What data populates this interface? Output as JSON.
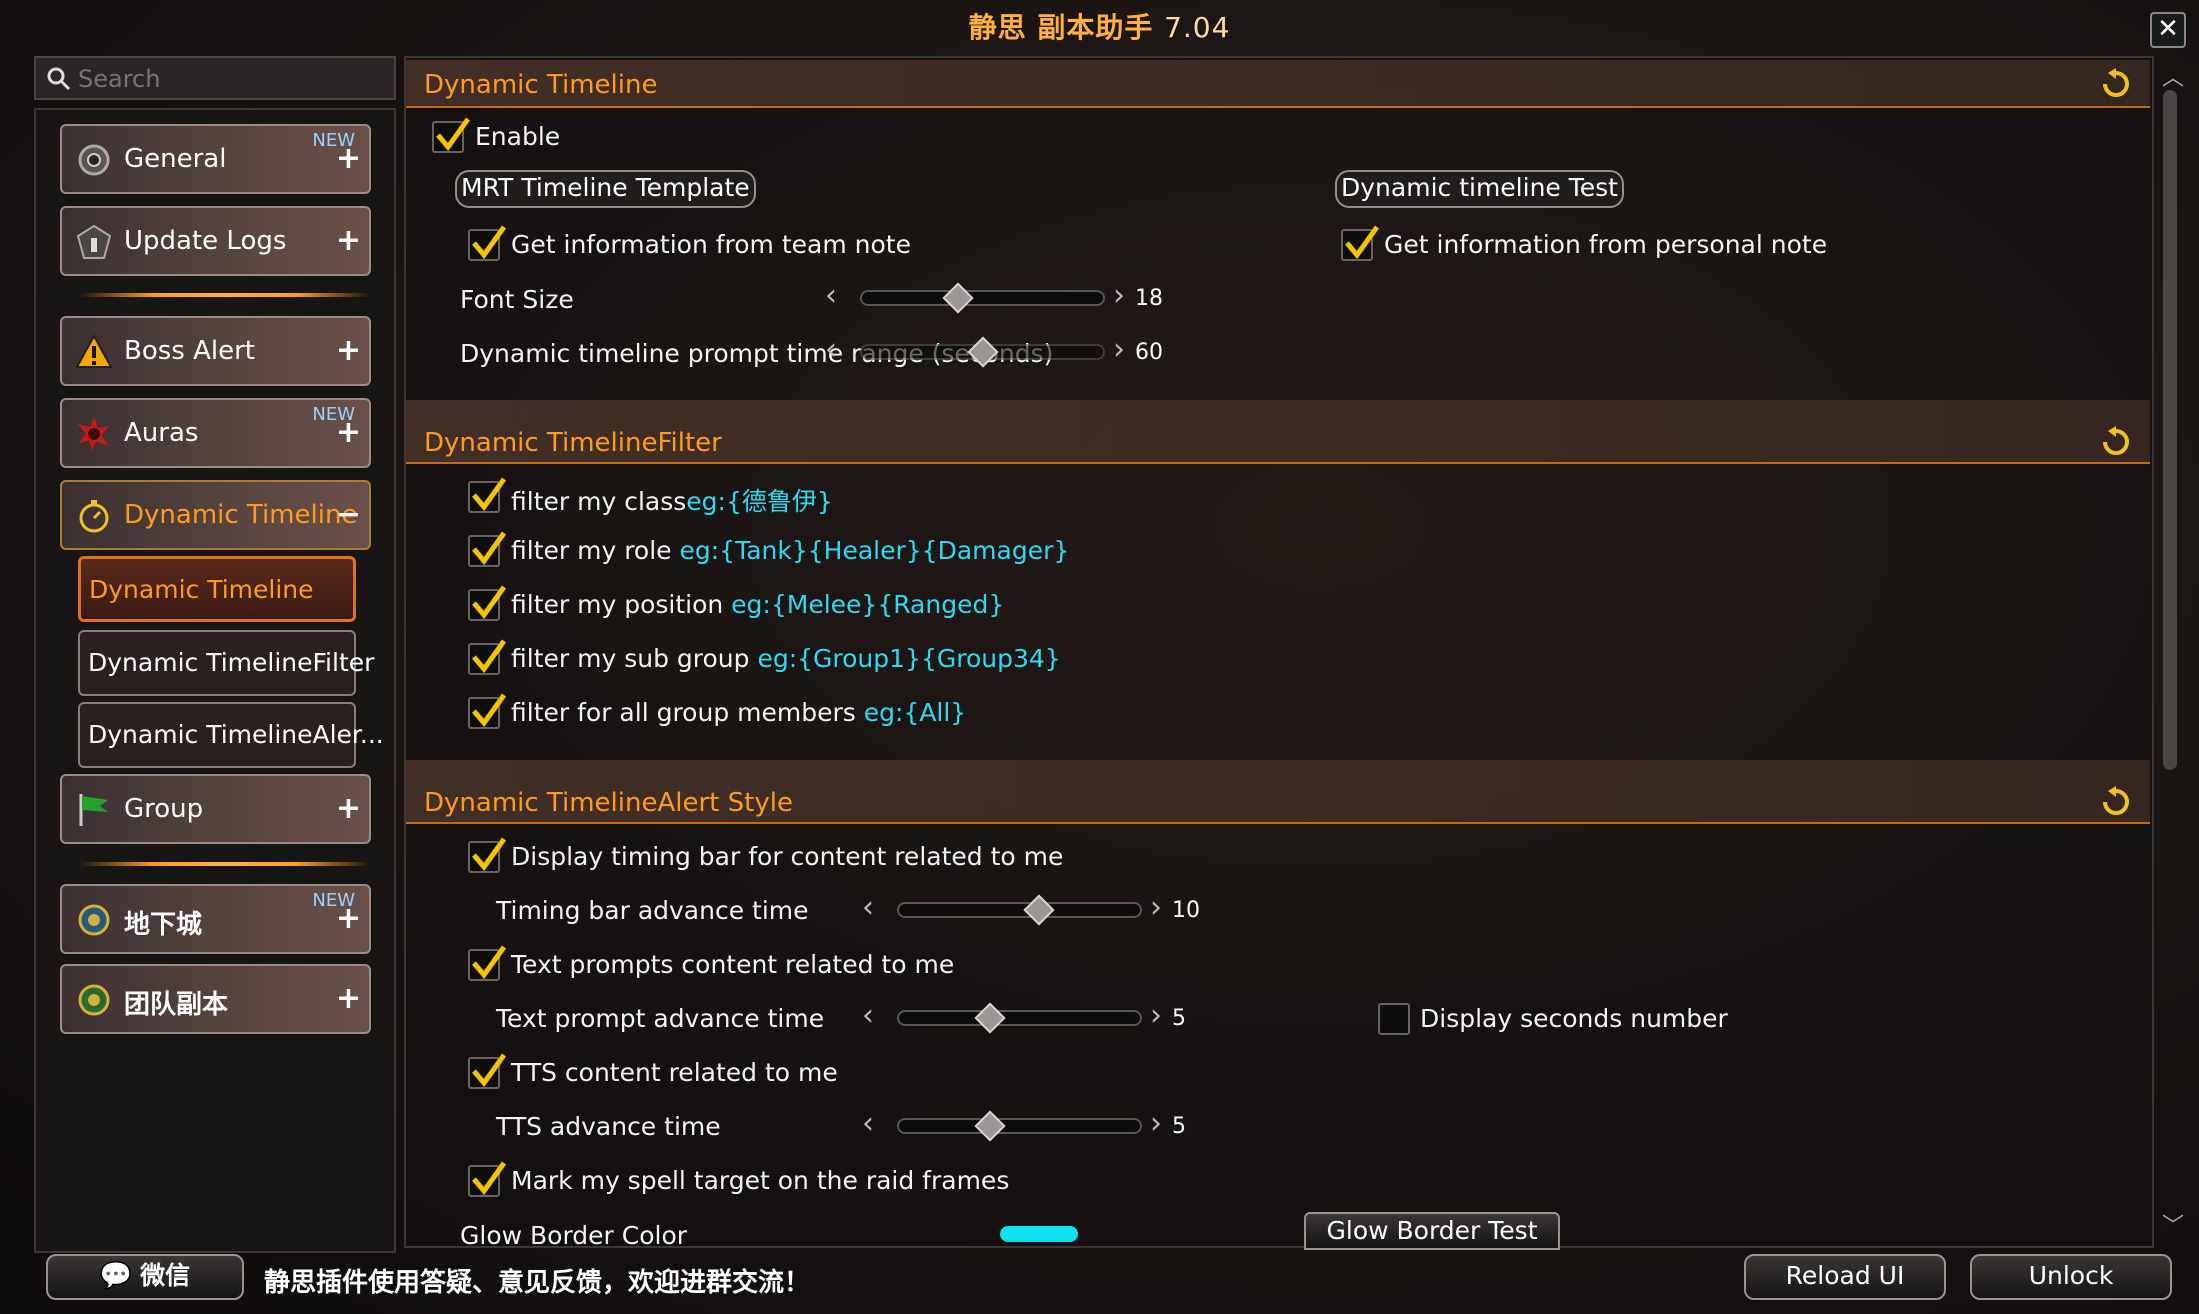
{
  "window": {
    "title": "静思 副本助手",
    "version": "7.04"
  },
  "search": {
    "placeholder": "Search"
  },
  "sidebar": {
    "nav": [
      {
        "label": "General",
        "badge": "NEW",
        "icon": "gear-icon",
        "expander": "+"
      },
      {
        "label": "Update Logs",
        "icon": "info-icon",
        "expander": "+"
      },
      {
        "label": "Boss Alert",
        "icon": "warning-icon",
        "expander": "+"
      },
      {
        "label": "Auras",
        "badge": "NEW",
        "icon": "aura-icon",
        "expander": "+"
      },
      {
        "label": "Dynamic Timeline",
        "icon": "stopwatch-icon",
        "expander": "−",
        "active": true
      },
      {
        "label": "Group",
        "icon": "flag-icon",
        "expander": "+"
      },
      {
        "label": "地下城",
        "badge": "NEW",
        "icon": "dungeon-icon",
        "expander": "+"
      },
      {
        "label": "团队副本",
        "icon": "raid-icon",
        "expander": "+"
      }
    ],
    "sub": [
      {
        "label": "Dynamic Timeline",
        "active": true
      },
      {
        "label": "Dynamic TimelineFilter"
      },
      {
        "label": "Dynamic TimelineAler..."
      }
    ]
  },
  "sections": {
    "timeline": {
      "title": "Dynamic Timeline",
      "enable": "Enable",
      "mrt_template": "MRT Timeline Template",
      "timeline_test": "Dynamic timeline Test",
      "team_note": "Get information from team note",
      "personal_note": "Get information from personal note",
      "font_size_label": "Font Size",
      "font_size_value": "18",
      "font_size_fraction": 0.4,
      "prompt_range_label": "Dynamic timeline prompt time range (seconds)",
      "prompt_range_value": "60",
      "prompt_range_fraction": 0.5
    },
    "filter": {
      "title": "Dynamic TimelineFilter",
      "items": [
        {
          "label": "filter my class",
          "hint": "eg:{德鲁伊}"
        },
        {
          "label": "filter my role ",
          "hint": "eg:{Tank}{Healer}{Damager}"
        },
        {
          "label": "filter my position ",
          "hint": "eg:{Melee}{Ranged}"
        },
        {
          "label": "filter my sub group ",
          "hint": "eg:{Group1}{Group34}"
        },
        {
          "label": "filter for all group members ",
          "hint": "eg:{All}"
        }
      ]
    },
    "alert": {
      "title": "Dynamic TimelineAlert Style",
      "display_bar": "Display timing bar for content related to me",
      "bar_advance_label": "Timing bar advance time",
      "bar_advance_value": "10",
      "bar_advance_fraction": 0.58,
      "text_prompts": "Text prompts content related to me",
      "text_advance_label": "Text prompt advance time",
      "text_advance_value": "5",
      "text_advance_fraction": 0.38,
      "display_seconds": "Display seconds number",
      "tts_content": "TTS content related to me",
      "tts_advance_label": "TTS advance time",
      "tts_advance_value": "5",
      "tts_advance_fraction": 0.38,
      "mark_target": "Mark my spell target on the raid frames",
      "glow_color_label": "Glow Border Color",
      "glow_color": "#10e0f0",
      "glow_test": "Glow Border Test"
    }
  },
  "footer": {
    "wechat": "微信",
    "message": "静思插件使用答疑、意见反馈，欢迎进群交流！",
    "reload": "Reload UI",
    "unlock": "Unlock"
  },
  "colors": {
    "accent": "#ff9a20",
    "hint": "#30d8f0",
    "divider": "#c66a18"
  }
}
